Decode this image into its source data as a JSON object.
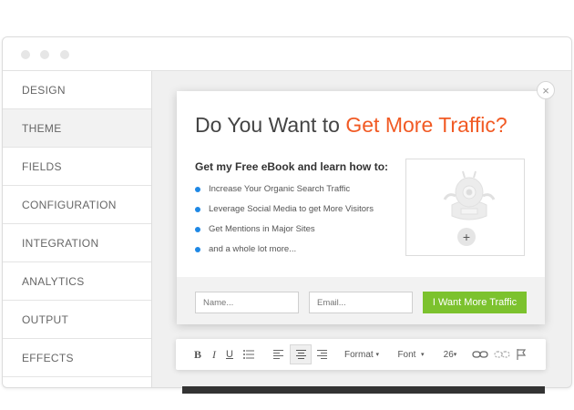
{
  "sidebar": {
    "items": [
      {
        "label": "DESIGN",
        "active": false
      },
      {
        "label": "THEME",
        "active": true
      },
      {
        "label": "FIELDS",
        "active": false
      },
      {
        "label": "CONFIGURATION",
        "active": false
      },
      {
        "label": "INTEGRATION",
        "active": false
      },
      {
        "label": "ANALYTICS",
        "active": false
      },
      {
        "label": "OUTPUT",
        "active": false
      },
      {
        "label": "EFFECTS",
        "active": false
      }
    ]
  },
  "popup": {
    "close_glyph": "×",
    "headline_prefix": "Do You Want to ",
    "headline_accent": "Get More Traffic?",
    "subhead": "Get my Free eBook and learn how to:",
    "bullets": [
      "Increase Your Organic Search Traffic",
      "Leverage Social Media to get More Visitors",
      "Get Mentions in Major Sites",
      "and a whole lot more..."
    ],
    "image_add_glyph": "+",
    "name_placeholder": "Name...",
    "email_placeholder": "Email...",
    "cta_label": "I Want More Traffic"
  },
  "toolbar": {
    "bold": "B",
    "italic": "I",
    "underline": "U",
    "format_label": "Format",
    "font_label": "Font",
    "size_label": "26",
    "dropdown_caret": "▾"
  },
  "colors": {
    "accent_orange": "#f15a24",
    "cta_green": "#7cc22e",
    "bullet_blue": "#1e88e5"
  },
  "icons": [
    "close-icon",
    "mascot-placeholder-icon",
    "add-image-icon",
    "list-icon",
    "align-left-icon",
    "align-center-icon",
    "align-right-icon",
    "link-icon",
    "unlink-icon",
    "flag-icon"
  ]
}
